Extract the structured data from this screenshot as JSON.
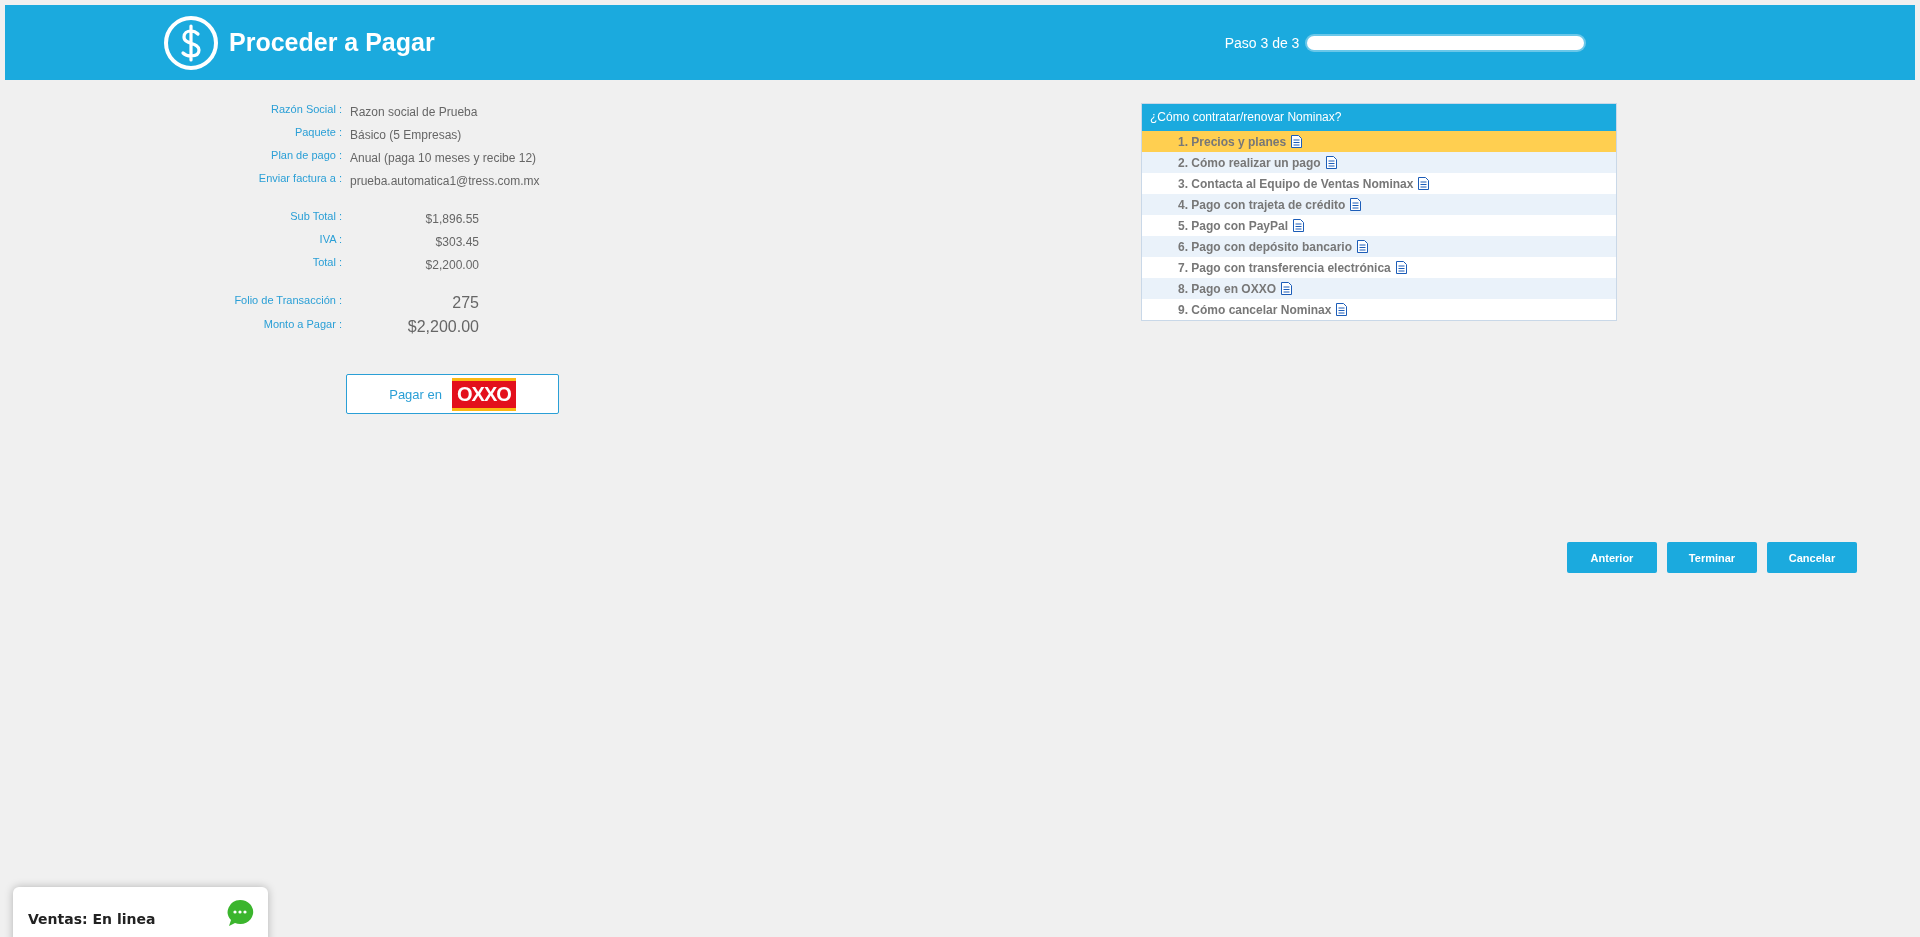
{
  "header": {
    "title": "Proceder a Pagar",
    "step": "Paso 3 de 3",
    "progress": {
      "level": 1
    }
  },
  "details": [
    {
      "label": "Razón Social :",
      "value": "Razon social de Prueba"
    },
    {
      "label": "Paquete :",
      "value": "Básico (5 Empresas)"
    },
    {
      "label": "Plan de pago :",
      "value": "Anual (paga 10 meses y recibe 12)"
    },
    {
      "label": "Enviar factura a :",
      "value": "prueba.automatica1@tress.com.mx"
    }
  ],
  "totals": [
    {
      "label": "Sub Total :",
      "value": "$1,896.55"
    },
    {
      "label": "IVA :",
      "value": "$303.45"
    },
    {
      "label": "Total :",
      "value": "$2,200.00"
    }
  ],
  "payment": [
    {
      "label": "Folio de Transacción :",
      "value": "275"
    },
    {
      "label": "Monto a Pagar :",
      "value": "$2,200.00"
    }
  ],
  "pay_button": {
    "label": "Pagar en",
    "logo": "OXXO"
  },
  "help": {
    "title": "¿Cómo contratar/renovar Nominax?",
    "items": [
      {
        "label": "1. Precios y planes",
        "selected": true
      },
      {
        "label": "2. Cómo realizar un pago",
        "selected": false
      },
      {
        "label": "3. Contacta al Equipo de Ventas Nominax",
        "selected": false
      },
      {
        "label": "4. Pago con trajeta de crédito",
        "selected": false
      },
      {
        "label": "5. Pago con PayPal",
        "selected": false
      },
      {
        "label": "6. Pago con depósito bancario",
        "selected": false
      },
      {
        "label": "7. Pago con transferencia electrónica",
        "selected": false
      },
      {
        "label": "8. Pago en OXXO",
        "selected": false
      },
      {
        "label": "9. Cómo cancelar Nominax",
        "selected": false
      }
    ]
  },
  "buttons": [
    "Anterior",
    "Terminar",
    "Cancelar"
  ],
  "chat": {
    "label": "Ventas: En linea"
  }
}
